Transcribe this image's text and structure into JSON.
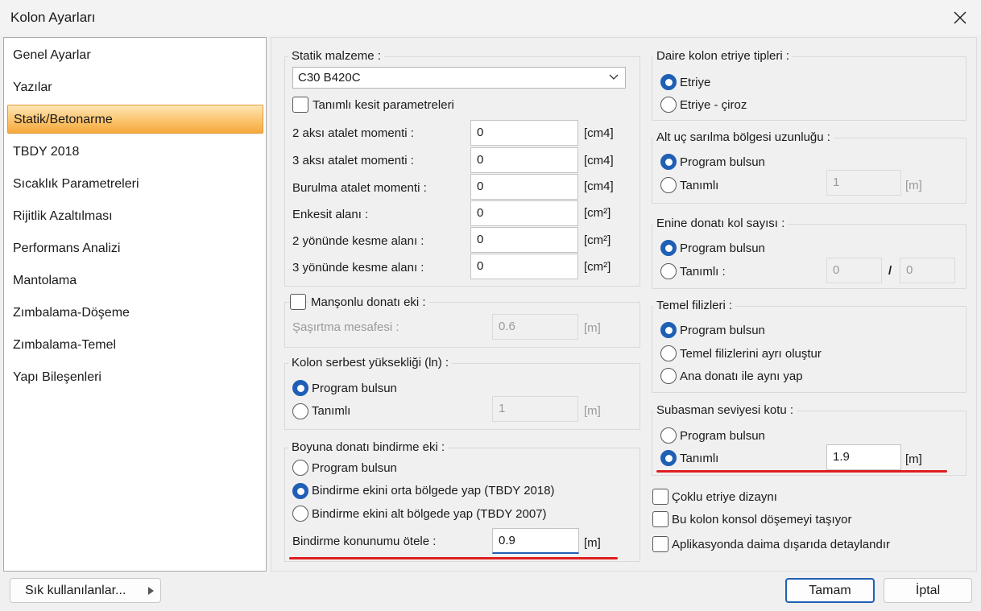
{
  "window": {
    "title": "Kolon Ayarları",
    "close_icon": "close-icon"
  },
  "sidebar": {
    "items": [
      {
        "label": "Genel Ayarlar"
      },
      {
        "label": "Yazılar"
      },
      {
        "label": "Statik/Betonarme"
      },
      {
        "label": "TBDY 2018"
      },
      {
        "label": "Sıcaklık Parametreleri"
      },
      {
        "label": "Rijitlik Azaltılması"
      },
      {
        "label": "Performans Analizi"
      },
      {
        "label": "Mantolama"
      },
      {
        "label": "Zımbalama-Döşeme"
      },
      {
        "label": "Zımbalama-Temel"
      },
      {
        "label": "Yapı Bileşenleri"
      }
    ],
    "selected_index": 2
  },
  "statik": {
    "label": "Statik malzeme :",
    "material": "C30 B420C",
    "tanimli_kesit": "Tanımlı kesit parametreleri",
    "rows": [
      {
        "label": "2 aksı atalet momenti :",
        "value": "0",
        "unit": "[cm4]"
      },
      {
        "label": "3 aksı atalet momenti :",
        "value": "0",
        "unit": "[cm4]"
      },
      {
        "label": "Burulma atalet momenti :",
        "value": "0",
        "unit": "[cm4]"
      },
      {
        "label": "Enkesit alanı :",
        "value": "0",
        "unit": "[cm²]"
      },
      {
        "label": "2 yönünde kesme alanı :",
        "value": "0",
        "unit": "[cm²]"
      },
      {
        "label": "3 yönünde kesme alanı :",
        "value": "0",
        "unit": "[cm²]"
      }
    ]
  },
  "manson": {
    "label": "Manşonlu donatı eki :",
    "sasirtma_label": "Şaşırtma mesafesi :",
    "sasirtma_value": "0.6",
    "unit": "[m]"
  },
  "serbest": {
    "label": "Kolon serbest yüksekliği (ln) :",
    "opt1": "Program bulsun",
    "opt2": "Tanımlı",
    "value": "1",
    "unit": "[m]"
  },
  "bindirme": {
    "label": "Boyuna donatı bindirme eki :",
    "opt1": "Program bulsun",
    "opt2": "Bindirme ekini orta bölgede yap (TBDY 2018)",
    "opt3": "Bindirme ekini alt bölgede yap  (TBDY 2007)",
    "otele_label": "Bindirme konunumu ötele :",
    "otele_value": "0.9",
    "unit": "[m]"
  },
  "daire": {
    "label": "Daire kolon etriye tipleri :",
    "opt1": "Etriye",
    "opt2": "Etriye - çiroz"
  },
  "altuc": {
    "label": "Alt uç sarılma bölgesi uzunluğu :",
    "opt1": "Program bulsun",
    "opt2": "Tanımlı",
    "value": "1",
    "unit": "[m]"
  },
  "enine": {
    "label": "Enine donatı kol sayısı :",
    "opt1": "Program bulsun",
    "opt2": "Tanımlı :",
    "value1": "0",
    "separator": "/",
    "value2": "0"
  },
  "temel": {
    "label": "Temel filizleri :",
    "opt1": "Program bulsun",
    "opt2": "Temel filizlerini ayrı oluştur",
    "opt3": "Ana donatı ile aynı yap"
  },
  "subasman": {
    "label": "Subasman seviyesi kotu  :",
    "opt1": "Program bulsun",
    "opt2": "Tanımlı",
    "value": "1.9",
    "unit": "[m]"
  },
  "checks": {
    "coklu": "Çoklu etriye dizaynı",
    "konsol": "Bu kolon konsol döşemeyi taşıyor",
    "aplikasyon": "Aplikasyonda daima dışarıda detaylandır"
  },
  "footer": {
    "sik": "Sık kullanılanlar...",
    "ok": "Tamam",
    "cancel": "İptal"
  },
  "colors": {
    "accent": "#1f5fb5",
    "highlight": "#e01e1e",
    "selection": "#fbc46e"
  }
}
